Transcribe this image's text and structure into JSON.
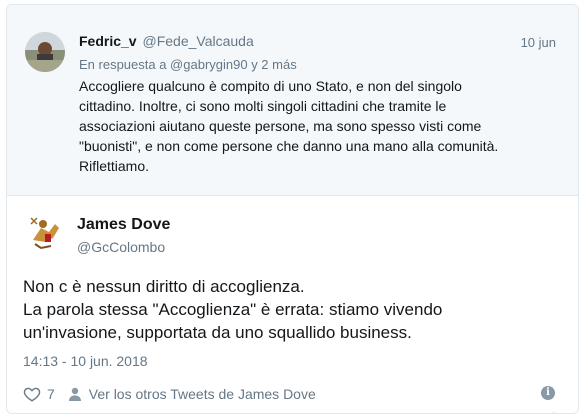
{
  "parent_tweet": {
    "author_name": "Fedric_v",
    "author_handle": "@Fede_Valcauda",
    "date": "10 jun",
    "reply_to": "En respuesta a @gabrygin90 y 2 más",
    "text_lines": [
      "Accogliere qualcuno è compito di uno Stato, e non del singolo",
      "cittadino. Inoltre, ci sono molti singoli cittadini che tramite le",
      "associazioni aiutano queste persone, ma sono spesso visti come",
      "\"buonisti\", e non come persone che danno una mano alla comunità.",
      "Riflettiamo."
    ]
  },
  "main_tweet": {
    "author_name": "James Dove",
    "author_handle": "@GcColombo",
    "text_lines": [
      "Non c è nessun diritto di accoglienza.",
      "La parola stessa \"Accoglienza\"  è errata: stiamo vivendo",
      "un'invasione, supportata da uno squallido business."
    ],
    "timestamp": "14:13 - 10 jun. 2018",
    "like_count": "7",
    "more_tweets_link": "Ver los otros Tweets de James Dove"
  },
  "icons": {
    "brand": "twitter-bird-icon",
    "like": "heart-icon",
    "profile": "person-icon",
    "info": "info-icon"
  },
  "colors": {
    "twitter_blue": "#1da1f2",
    "secondary_text": "#657786",
    "parent_background": "#f5f8fa"
  }
}
